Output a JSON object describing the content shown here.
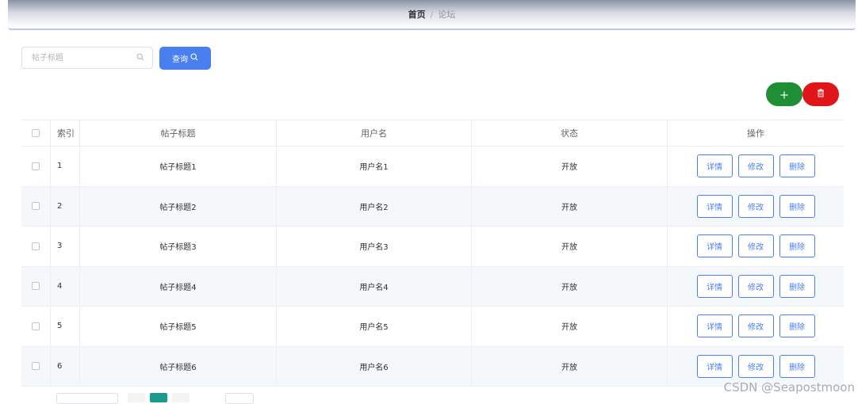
{
  "breadcrumb": {
    "home": "首页",
    "separator": "/",
    "current": "论坛"
  },
  "search": {
    "placeholder": "帖子标题",
    "query_label": "查询"
  },
  "colors": {
    "primary": "#4a7ff0",
    "add": "#1f8e34",
    "delete": "#e0151a",
    "pager_active": "#1a9b8b"
  },
  "icons": {
    "add": "plus-icon",
    "delete": "trash-icon",
    "search": "search-icon"
  },
  "table": {
    "headers": {
      "index": "索引",
      "title": "帖子标题",
      "username": "用户名",
      "status": "状态",
      "actions": "操作"
    },
    "rows": [
      {
        "index": "1",
        "title": "帖子标题1",
        "username": "用户名1",
        "status": "开放"
      },
      {
        "index": "2",
        "title": "帖子标题2",
        "username": "用户名2",
        "status": "开放"
      },
      {
        "index": "3",
        "title": "帖子标题3",
        "username": "用户名3",
        "status": "开放"
      },
      {
        "index": "4",
        "title": "帖子标题4",
        "username": "用户名4",
        "status": "开放"
      },
      {
        "index": "5",
        "title": "帖子标题5",
        "username": "用户名5",
        "status": "开放"
      },
      {
        "index": "6",
        "title": "帖子标题6",
        "username": "用户名6",
        "status": "开放"
      }
    ],
    "row_actions": {
      "detail": "详情",
      "edit": "修改",
      "delete": "删除"
    }
  },
  "watermark": "CSDN @Seapostmoon"
}
